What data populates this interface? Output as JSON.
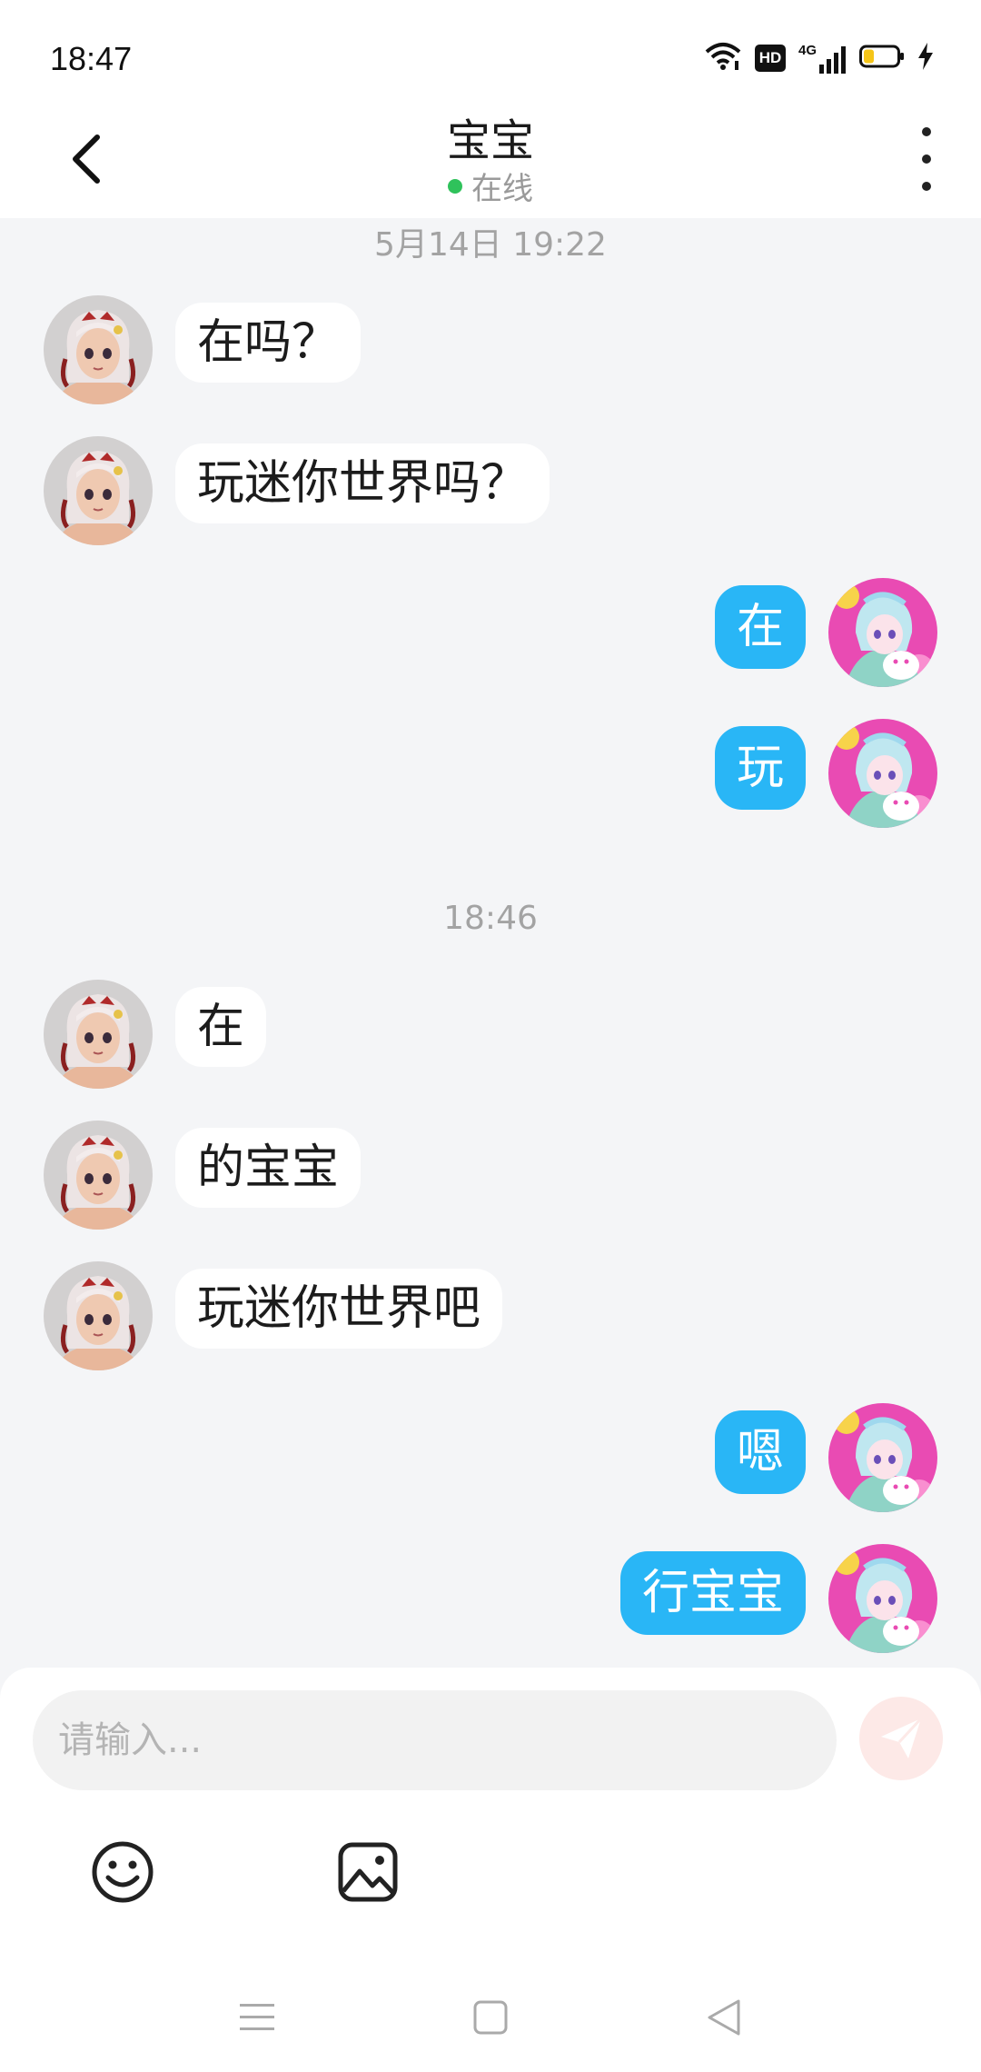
{
  "status_bar": {
    "time": "18:47",
    "icons": [
      "wifi-icon",
      "hd-icon",
      "signal-4g-icon",
      "battery-icon",
      "charging-icon"
    ],
    "hd_label": "HD",
    "network_label": "4G"
  },
  "header": {
    "title": "宝宝",
    "status": "在线",
    "status_color": "#2fc25b"
  },
  "chat": {
    "timestamps": [
      "5月14日 19:22",
      "18:46"
    ],
    "messages": [
      {
        "side": "left",
        "text": "在吗？"
      },
      {
        "side": "left",
        "text": "玩迷你世界吗？"
      },
      {
        "side": "right",
        "text": "在"
      },
      {
        "side": "right",
        "text": "玩"
      },
      {
        "side": "left",
        "text": "在"
      },
      {
        "side": "left",
        "text": "的宝宝"
      },
      {
        "side": "left",
        "text": "玩迷你世界吧"
      },
      {
        "side": "right",
        "text": "嗯"
      },
      {
        "side": "right",
        "text": "行宝宝"
      }
    ]
  },
  "input": {
    "placeholder": "请输入...",
    "value": ""
  },
  "toolbar": {
    "icons": [
      "emoji-icon",
      "image-icon"
    ]
  },
  "colors": {
    "self_bubble": "#29b6f6",
    "other_bubble": "#ffffff",
    "chat_background": "#f4f5f7",
    "send_button": "#fde9e7"
  },
  "nav_bar": {
    "icons": [
      "menu-icon",
      "home-icon",
      "back-triangle-icon"
    ]
  }
}
